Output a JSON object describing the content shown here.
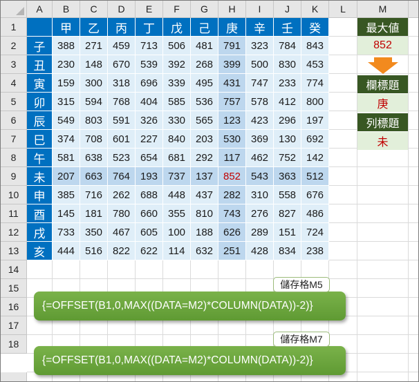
{
  "columns": [
    "A",
    "B",
    "C",
    "D",
    "E",
    "F",
    "G",
    "H",
    "I",
    "J",
    "K",
    "L",
    "M"
  ],
  "rows": [
    "1",
    "2",
    "3",
    "4",
    "5",
    "6",
    "7",
    "8",
    "9",
    "10",
    "11",
    "12",
    "13",
    "14",
    "15",
    "16",
    "17",
    "18"
  ],
  "table": {
    "col_headers": [
      "甲",
      "乙",
      "丙",
      "丁",
      "戊",
      "己",
      "庚",
      "辛",
      "壬",
      "癸"
    ],
    "row_headers": [
      "子",
      "丑",
      "寅",
      "卯",
      "辰",
      "巳",
      "午",
      "未",
      "申",
      "酉",
      "戌",
      "亥"
    ],
    "values": [
      [
        "388",
        "271",
        "459",
        "713",
        "506",
        "481",
        "791",
        "323",
        "784",
        "843"
      ],
      [
        "230",
        "148",
        "670",
        "539",
        "392",
        "268",
        "399",
        "500",
        "830",
        "453"
      ],
      [
        "159",
        "300",
        "318",
        "696",
        "339",
        "495",
        "431",
        "747",
        "233",
        "774"
      ],
      [
        "315",
        "594",
        "768",
        "404",
        "585",
        "536",
        "757",
        "578",
        "412",
        "800"
      ],
      [
        "549",
        "803",
        "591",
        "326",
        "330",
        "565",
        "123",
        "423",
        "296",
        "197"
      ],
      [
        "374",
        "708",
        "601",
        "227",
        "840",
        "203",
        "530",
        "369",
        "130",
        "692"
      ],
      [
        "581",
        "638",
        "523",
        "654",
        "681",
        "292",
        "117",
        "462",
        "752",
        "142"
      ],
      [
        "207",
        "663",
        "764",
        "193",
        "737",
        "137",
        "852",
        "543",
        "363",
        "512"
      ],
      [
        "385",
        "716",
        "262",
        "688",
        "448",
        "437",
        "282",
        "310",
        "558",
        "676"
      ],
      [
        "145",
        "181",
        "780",
        "660",
        "355",
        "810",
        "743",
        "276",
        "827",
        "486"
      ],
      [
        "733",
        "350",
        "467",
        "605",
        "100",
        "188",
        "626",
        "289",
        "151",
        "724"
      ],
      [
        "444",
        "516",
        "822",
        "622",
        "114",
        "632",
        "251",
        "428",
        "834",
        "238"
      ]
    ]
  },
  "side_panel": {
    "max_label": "最大値",
    "max_value": "852",
    "col_title_label": "欄標題",
    "col_title_value": "庚",
    "row_title_label": "列標題",
    "row_title_value": "未"
  },
  "formulas": [
    {
      "tag": "儲存格M5",
      "formula": "{=OFFSET(B1,0,MAX((DATA=M2)*COLUMN(DATA))-2)}"
    },
    {
      "tag": "儲存格M7",
      "formula": "{=OFFSET(B1,0,MAX((DATA=M2)*COLUMN(DATA))-2)}"
    }
  ],
  "colors": {
    "header_blue": "#0070c0",
    "data_fill": "#dfeef8",
    "highlight_fill": "#bdd7ee",
    "side_dark_green": "#385723",
    "side_pale_green": "#e2efda",
    "max_red": "#c00000",
    "arrow_orange": "#f28a1e",
    "formula_green": "#6aa63c"
  },
  "highlight": {
    "row_index": 7,
    "col_index": 6
  }
}
